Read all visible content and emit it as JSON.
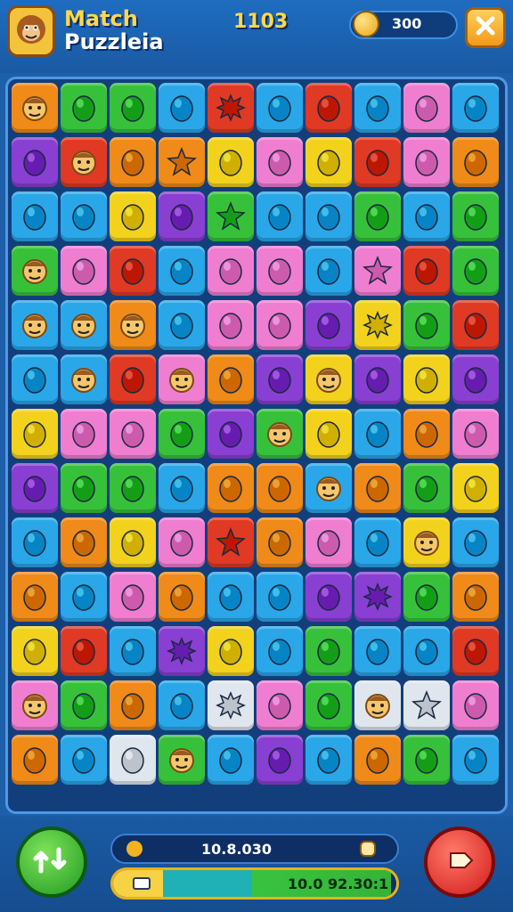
{
  "header": {
    "title_line1": "Match",
    "title_line2": "Puzzleia",
    "score": "1103",
    "coins": "300",
    "avatar_icon": "monkey-face-icon",
    "close_icon": "close-x-icon"
  },
  "footer": {
    "shuffle_icon": "shuffle-arrows-icon",
    "play_icon": "play-arrow-icon",
    "bar_top_text": "10.8.030",
    "bar_bottom_text": "10.0 92.30:1",
    "progress": 0.98
  },
  "colors": {
    "O": "#f08a18",
    "G": "#37c13a",
    "B": "#2aa7e8",
    "R": "#e03a24",
    "P": "#f07ed0",
    "Y": "#f3d21e",
    "V": "#8a3fd3",
    "T": "#2bb6d6",
    "W": "#dfe6ee"
  },
  "board": {
    "rows": [
      [
        "O:face",
        "G:drop",
        "G:drop",
        "B:drop",
        "R:splat",
        "B:drop",
        "R:drop",
        "B:drop",
        "P:drop",
        "B:drop"
      ],
      [
        "V:drop",
        "R:face",
        "O:drop",
        "O:star",
        "Y:drop",
        "P:drop",
        "Y:drop",
        "R:drop",
        "P:drop",
        "O:drop"
      ],
      [
        "B:drop",
        "B:drop",
        "Y:drop",
        "V:drop",
        "G:star",
        "B:drop",
        "B:drop",
        "G:drop",
        "B:drop",
        "G:drop"
      ],
      [
        "G:face",
        "P:drop",
        "R:drop",
        "B:drop",
        "P:drop",
        "P:drop",
        "B:drop",
        "P:star",
        "R:drop",
        "G:drop"
      ],
      [
        "B:face",
        "B:face",
        "O:face",
        "B:drop",
        "P:drop",
        "P:drop",
        "V:drop",
        "Y:splat",
        "G:drop",
        "R:drop"
      ],
      [
        "B:drop",
        "B:face",
        "R:drop",
        "P:face",
        "O:drop",
        "V:drop",
        "Y:face",
        "V:drop",
        "Y:drop",
        "V:drop"
      ],
      [
        "Y:drop",
        "P:drop",
        "P:drop",
        "G:drop",
        "V:drop",
        "G:face",
        "Y:drop",
        "B:drop",
        "O:drop",
        "P:drop"
      ],
      [
        "V:drop",
        "G:drop",
        "G:drop",
        "B:drop",
        "O:drop",
        "O:drop",
        "B:face",
        "O:drop",
        "G:drop",
        "Y:drop"
      ],
      [
        "B:drop",
        "O:drop",
        "Y:drop",
        "P:drop",
        "R:star",
        "O:drop",
        "P:drop",
        "B:drop",
        "Y:face",
        "B:drop"
      ],
      [
        "O:drop",
        "B:drop",
        "P:drop",
        "O:drop",
        "B:drop",
        "B:drop",
        "V:drop",
        "V:splat",
        "G:drop",
        "O:drop"
      ],
      [
        "Y:drop",
        "R:drop",
        "B:drop",
        "V:splat",
        "Y:drop",
        "B:drop",
        "G:drop",
        "B:drop",
        "B:drop",
        "R:drop"
      ],
      [
        "P:face",
        "G:drop",
        "O:drop",
        "B:drop",
        "W:splat",
        "P:drop",
        "G:drop",
        "W:face",
        "W:star",
        "P:drop"
      ],
      [
        "O:drop",
        "B:drop",
        "W:drop",
        "G:face",
        "B:drop",
        "V:drop",
        "B:drop",
        "O:drop",
        "G:drop",
        "B:drop"
      ]
    ]
  }
}
